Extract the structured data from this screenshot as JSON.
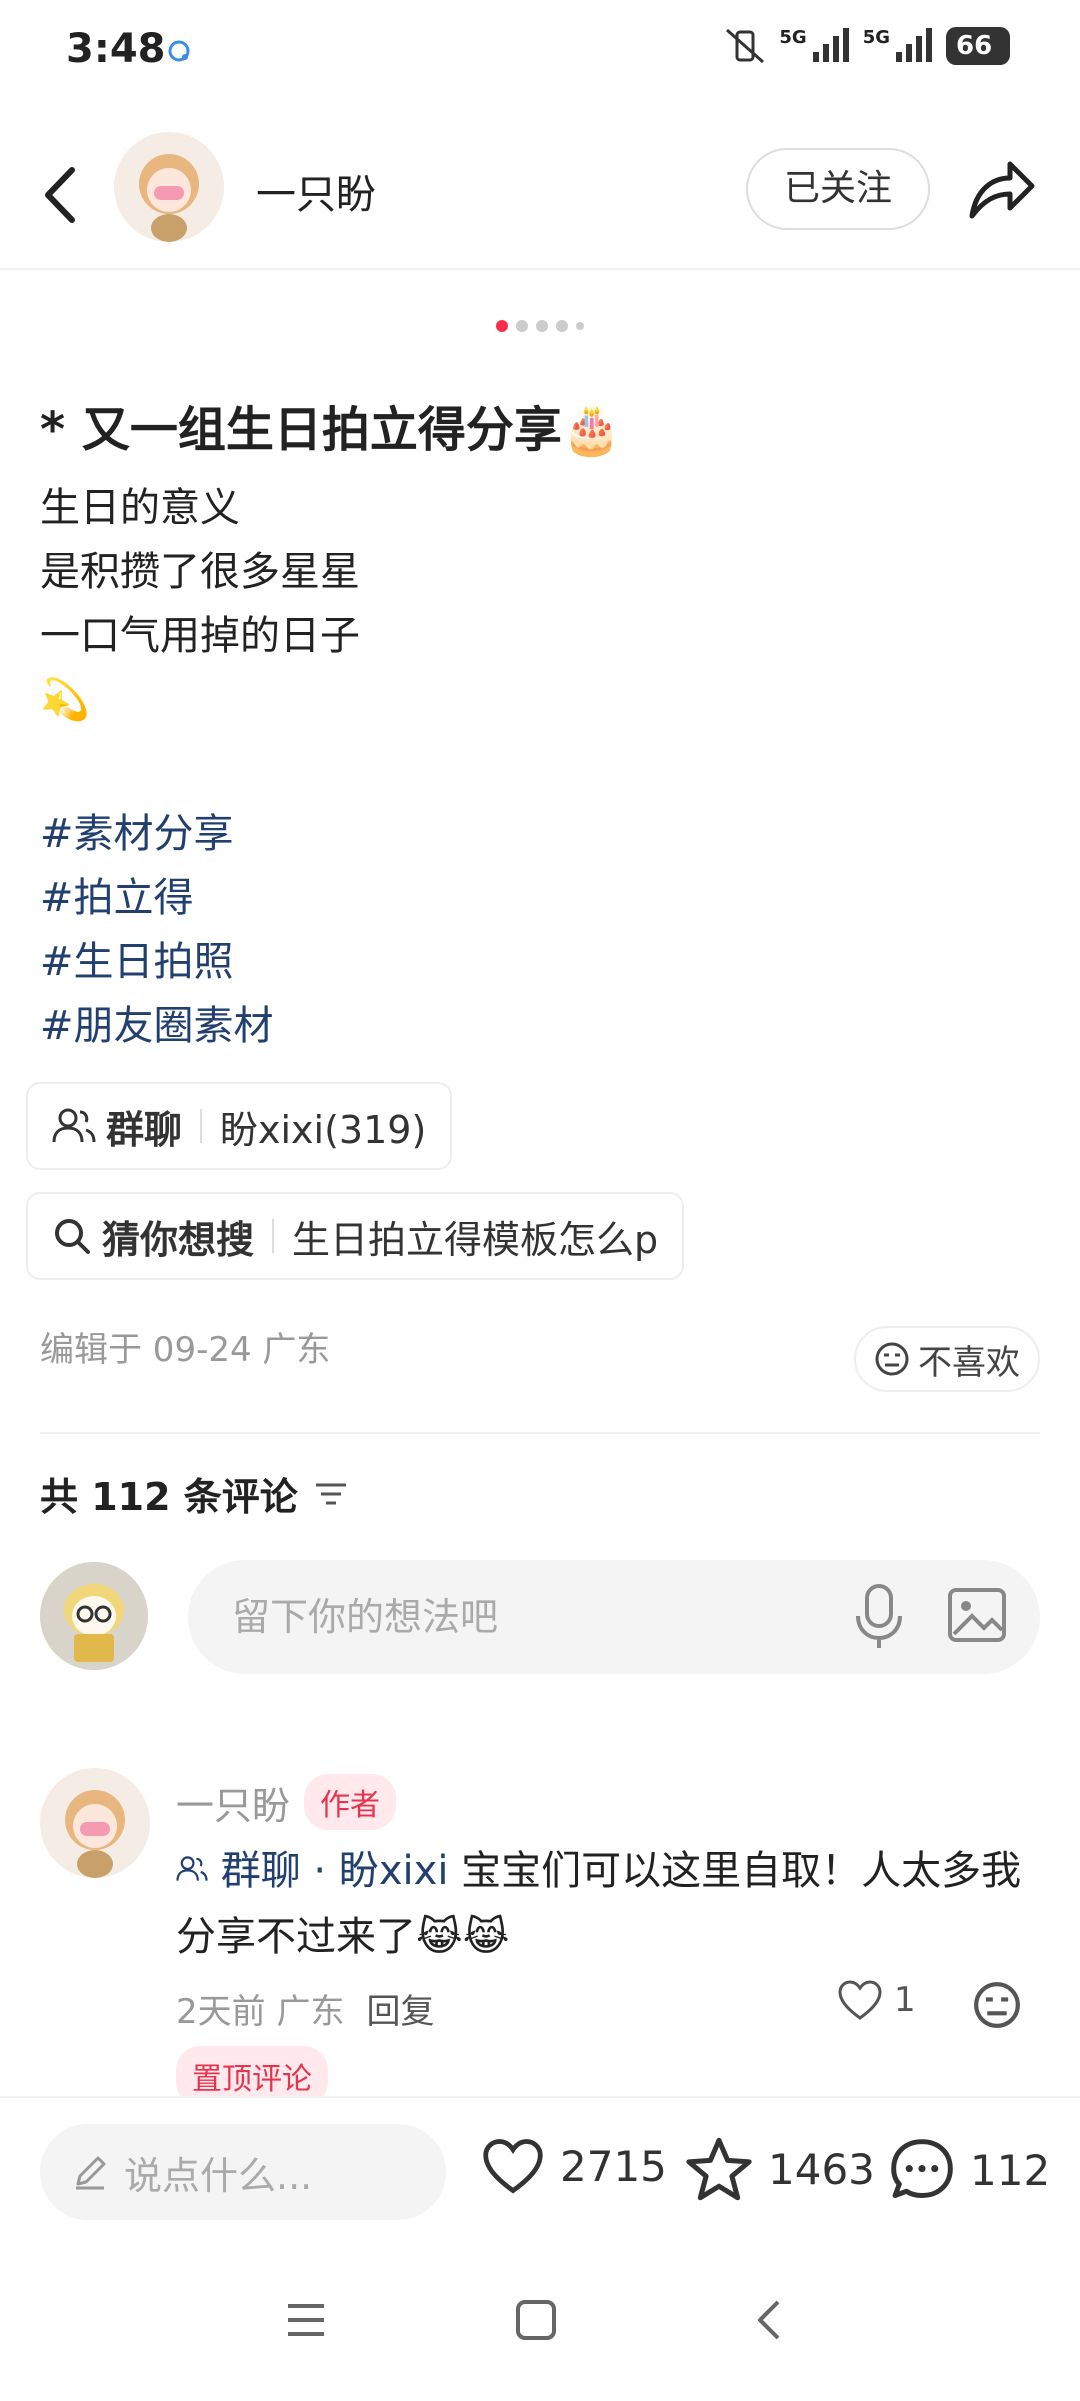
{
  "status_bar": {
    "time": "3:48",
    "network_1": "5G",
    "network_2": "5G",
    "battery": "66"
  },
  "header": {
    "author_name": "一只盼",
    "follow_label": "已关注"
  },
  "post": {
    "title": "* 又一组生日拍立得分享🎂",
    "body_lines": [
      "生日的意义",
      "是积攒了很多星星",
      "一口气用掉的日子",
      "💫"
    ],
    "tags": [
      "#素材分享",
      "#拍立得",
      "#生日拍照",
      "#朋友圈素材"
    ],
    "group_chip": {
      "label": "群聊",
      "value": "盼xixi(319)"
    },
    "search_chip": {
      "label": "猜你想搜",
      "value": "生日拍立得模板怎么p"
    },
    "edit_meta": "编辑于 09-24 广东",
    "dislike_label": "不喜欢"
  },
  "comments": {
    "count_label": "共 112 条评论",
    "input_placeholder": "留下你的想法吧",
    "items": [
      {
        "author": "一只盼",
        "author_tag": "作者",
        "link": "群聊 · 盼xixi",
        "text": " 宝宝们可以这里自取！人太多我分享不过来了😹😹",
        "time_loc": "2天前 广东",
        "reply_label": "回复",
        "likes": "1",
        "pinned_label": "置顶评论"
      }
    ]
  },
  "bottom_bar": {
    "say_placeholder": "说点什么...",
    "likes": "2715",
    "favorites": "1463",
    "comments": "112"
  },
  "colors": {
    "accent": "#ff2d4a",
    "link": "#22406f"
  }
}
